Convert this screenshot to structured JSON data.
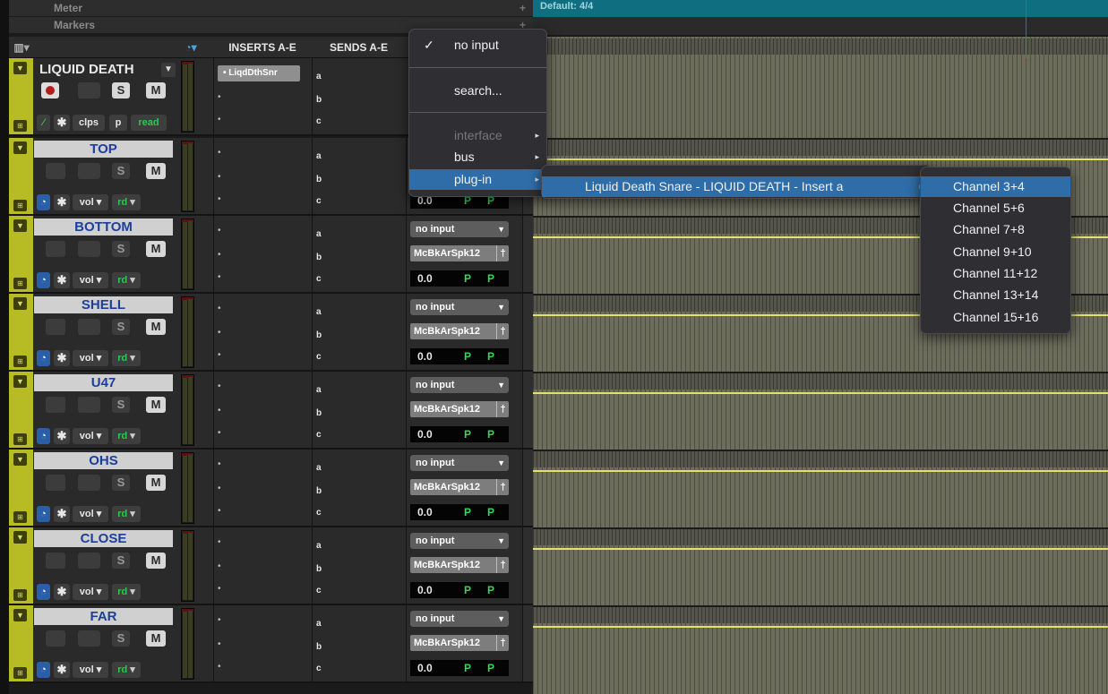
{
  "header": {
    "meter": "Meter",
    "markers": "Markers",
    "timesig": "Default: 4/4",
    "plus": "+"
  },
  "columns": {
    "inserts": "INSERTS A-E",
    "sends": "SENDS A-E"
  },
  "first_track": {
    "name": "LIQUID DEATH",
    "insert": "LiqdDthSnr",
    "clps": "clps",
    "p": "p",
    "read": "read"
  },
  "letters": [
    "a",
    "b",
    "c"
  ],
  "tracks": [
    {
      "name": "TOP"
    },
    {
      "name": "BOTTOM"
    },
    {
      "name": "SHELL"
    },
    {
      "name": "U47"
    },
    {
      "name": "OHS"
    },
    {
      "name": "CLOSE"
    },
    {
      "name": "FAR"
    }
  ],
  "common": {
    "S": "S",
    "M": "M",
    "vol": "vol",
    "rd": "rd",
    "no_input": "no input",
    "output": "McBkArSpk12",
    "volume": "0.0",
    "P": "P",
    "star": "✱"
  },
  "menu": {
    "no_input": "no input",
    "check": "✓",
    "search": "search...",
    "interface": "interface",
    "bus": "bus",
    "plugin": "plug-in"
  },
  "submenu": {
    "item": "Liquid Death Snare - LIQUID DEATH - Insert a"
  },
  "channels": [
    "Channel 3+4",
    "Channel 5+6",
    "Channel 7+8",
    "Channel 9+10",
    "Channel 11+12",
    "Channel 13+14",
    "Channel 15+16"
  ]
}
